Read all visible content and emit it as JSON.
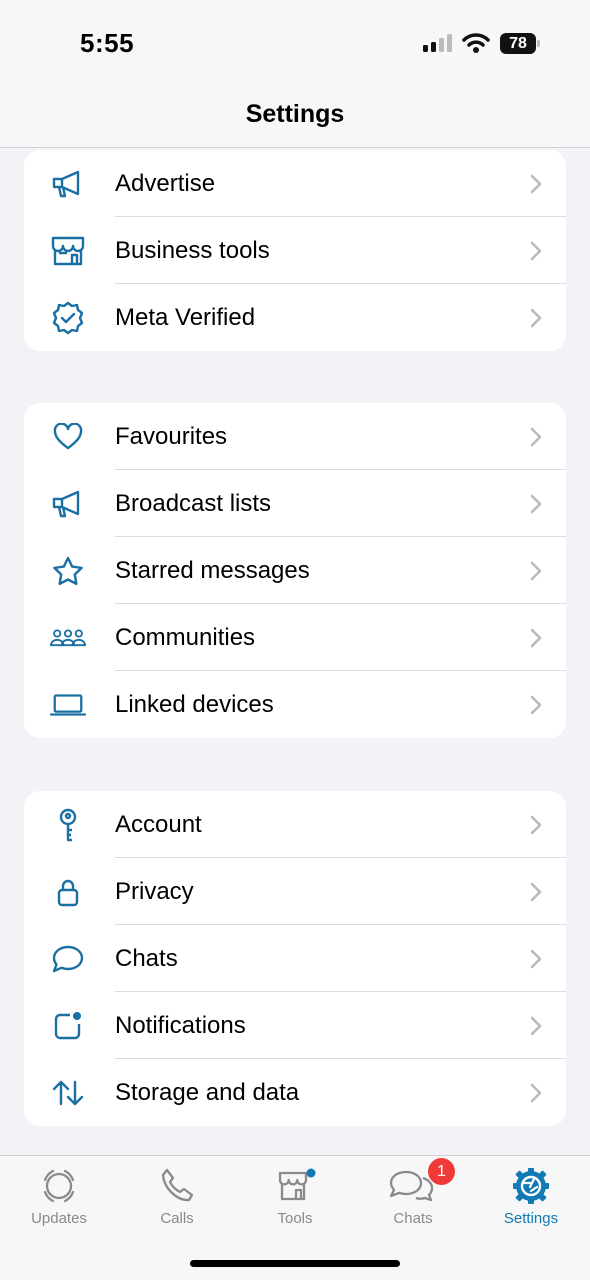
{
  "status_bar": {
    "time": "5:55",
    "battery": "78"
  },
  "header": {
    "title": "Settings"
  },
  "groups": [
    {
      "items": [
        {
          "label": "Advertise",
          "icon": "megaphone-icon"
        },
        {
          "label": "Business tools",
          "icon": "storefront-icon"
        },
        {
          "label": "Meta Verified",
          "icon": "verified-badge-icon"
        }
      ]
    },
    {
      "items": [
        {
          "label": "Favourites",
          "icon": "heart-icon"
        },
        {
          "label": "Broadcast lists",
          "icon": "megaphone-icon"
        },
        {
          "label": "Starred messages",
          "icon": "star-icon"
        },
        {
          "label": "Communities",
          "icon": "people-group-icon"
        },
        {
          "label": "Linked devices",
          "icon": "laptop-icon"
        }
      ]
    },
    {
      "items": [
        {
          "label": "Account",
          "icon": "key-icon"
        },
        {
          "label": "Privacy",
          "icon": "lock-icon"
        },
        {
          "label": "Chats",
          "icon": "chat-bubble-icon"
        },
        {
          "label": "Notifications",
          "icon": "notification-dot-icon"
        },
        {
          "label": "Storage and data",
          "icon": "up-down-arrows-icon"
        }
      ]
    }
  ],
  "tabs": [
    {
      "label": "Updates",
      "icon": "updates-icon"
    },
    {
      "label": "Calls",
      "icon": "phone-icon"
    },
    {
      "label": "Tools",
      "icon": "storefront-icon"
    },
    {
      "label": "Chats",
      "icon": "chat-bubbles-icon",
      "badge": "1"
    },
    {
      "label": "Settings",
      "icon": "gear-icon",
      "active": true
    }
  ],
  "colors": {
    "accent": "#117ab5",
    "icon_blue": "#1a6fa3",
    "badge_red": "#f03a3a",
    "background": "#f2f2f7"
  }
}
